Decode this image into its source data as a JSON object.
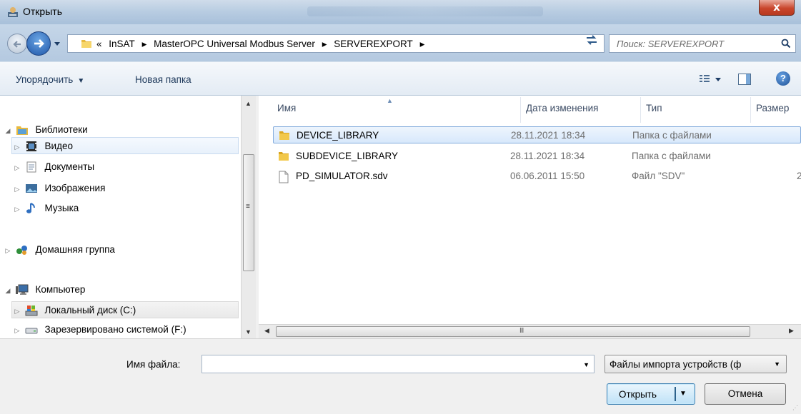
{
  "window": {
    "title": "Открыть",
    "close_label": "x"
  },
  "address": {
    "prefix": "«",
    "crumbs": [
      "InSAT",
      "MasterOPC Universal Modbus Server",
      "SERVEREXPORT"
    ],
    "separator": "▸"
  },
  "search": {
    "placeholder": "Поиск: SERVEREXPORT"
  },
  "toolbar": {
    "organize_label": "Упорядочить",
    "new_folder_label": "Новая папка"
  },
  "nav": {
    "libraries": "Библиотеки",
    "video": "Видео",
    "documents": "Документы",
    "images": "Изображения",
    "music": "Музыка",
    "homegroup": "Домашняя группа",
    "computer": "Компьютер",
    "local_disk": "Локальный диск (C:)",
    "reserved": "Зарезервировано системой (F:)"
  },
  "columns": {
    "name": "Имя",
    "date": "Дата изменения",
    "type": "Тип",
    "size": "Размер"
  },
  "files": [
    {
      "name": "DEVICE_LIBRARY",
      "date": "28.11.2021 18:34",
      "type": "Папка с файлами",
      "size": "",
      "kind": "folder"
    },
    {
      "name": "SUBDEVICE_LIBRARY",
      "date": "28.11.2021 18:34",
      "type": "Папка с файлами",
      "size": "",
      "kind": "folder"
    },
    {
      "name": "PD_SIMULATOR.sdv",
      "date": "06.06.2011 15:50",
      "type": "Файл \"SDV\"",
      "size": "2",
      "kind": "file"
    }
  ],
  "bottom": {
    "filename_label": "Имя файла:",
    "filename_value": "",
    "filter_value": "Файлы импорта устройств (ф",
    "open_label": "Открыть",
    "cancel_label": "Отмена"
  },
  "scroll": {
    "grip": "III"
  }
}
